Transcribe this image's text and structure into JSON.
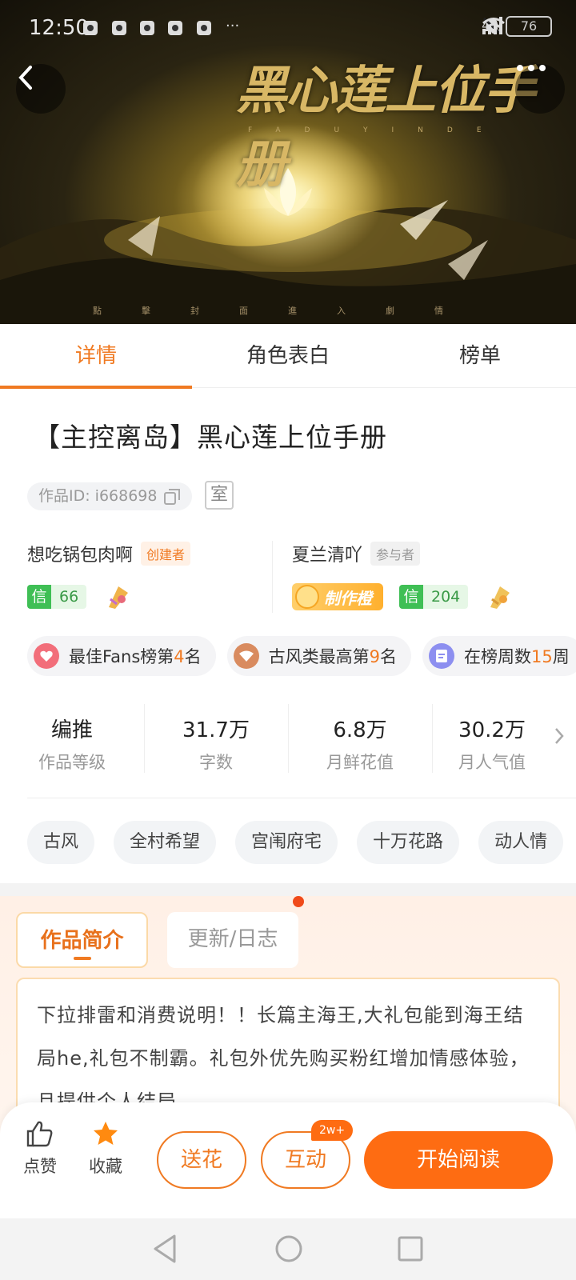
{
  "status_bar": {
    "time": "12:50",
    "network": "4G",
    "battery": "76"
  },
  "cover": {
    "title": "黑心莲上位手册",
    "subtitle": "FADUYINDE",
    "footer": "點擊封面進入劇情"
  },
  "tabs": [
    {
      "label": "详情",
      "active": true
    },
    {
      "label": "角色表白",
      "active": false
    },
    {
      "label": "榜单",
      "active": false
    }
  ],
  "book": {
    "title": "【主控离岛】黑心莲上位手册",
    "work_id": "作品ID: i668698",
    "room_tag": "室"
  },
  "creator": {
    "name": "想吃锅包肉啊",
    "role": "创建者",
    "xin_key": "信",
    "xin_value": "66"
  },
  "participant": {
    "name": "夏兰清吖",
    "role": "参与者",
    "badge": "制作橙",
    "xin_key": "信",
    "xin_value": "204"
  },
  "rankings": [
    {
      "prefix": "最佳Fans榜第",
      "num": "4",
      "suffix": "名",
      "color": "#f26e7a"
    },
    {
      "prefix": "古风类最高第",
      "num": "9",
      "suffix": "名",
      "color": "#d98b5f"
    },
    {
      "prefix": "在榜周数",
      "num": "15",
      "suffix": "周",
      "color": "#8d8ff0"
    }
  ],
  "stats": [
    {
      "value": "编推",
      "label": "作品等级"
    },
    {
      "value": "31.7万",
      "label": "字数"
    },
    {
      "value": "6.8万",
      "label": "月鲜花值"
    },
    {
      "value": "30.2万",
      "label": "月人气值"
    }
  ],
  "genres": [
    "古风",
    "全村希望",
    "宫闱府宅",
    "十万花路",
    "动人情"
  ],
  "intro": {
    "tab_active": "作品简介",
    "tab_other": "更新/日志",
    "text": "下拉排雷和消费说明！！长篇主海王,大礼包能到海王结局he,礼包不制霸。礼包外优先购买粉红增加情感体验，且提供个人结局"
  },
  "actions": {
    "like_label": "点赞",
    "collect_label": "收藏",
    "flower_label": "送花",
    "interact_label": "互动",
    "interact_badge": "2w+",
    "read_label": "开始阅读"
  },
  "colors": {
    "accent": "#f07a22",
    "primary_button": "#fe6c12",
    "xin_green": "#3fbf55"
  }
}
